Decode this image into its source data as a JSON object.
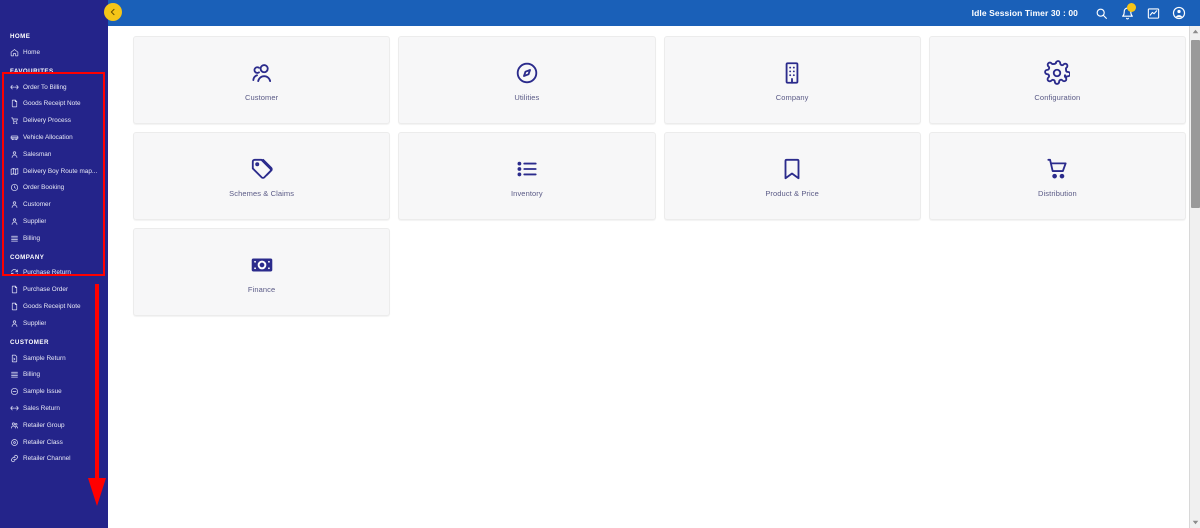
{
  "colors": {
    "header_blue": "#1a60b8",
    "sidebar_navy": "#24248a",
    "accent_yellow": "#f5c518",
    "icon_indigo": "#2b2b8c",
    "tile_bg": "#f7f7f8",
    "tile_label": "#5a5a86",
    "annotation_red": "#ff0000"
  },
  "topbar": {
    "collapse_icon": "chevron-left-icon",
    "idle_session_timer": "Idle Session Timer 30 : 00",
    "icons": [
      {
        "name": "search-icon",
        "label": "Search"
      },
      {
        "name": "notification-bell-icon",
        "label": "Notifications",
        "badge": ""
      },
      {
        "name": "analytics-chart-icon",
        "label": "Reports"
      },
      {
        "name": "user-account-icon",
        "label": "Account"
      }
    ]
  },
  "sidebar": {
    "scrollbar": {
      "up_arrow_icon": "caret-up-icon",
      "down_arrow_icon": "caret-down-icon"
    },
    "groups": [
      {
        "title": "HOME",
        "items": [
          {
            "label": "Home",
            "icon": "home-icon"
          }
        ]
      },
      {
        "title": "FAVOURITES",
        "items": [
          {
            "label": "Order To Billing",
            "icon": "arrows-horizontal-icon"
          },
          {
            "label": "Goods Receipt Note",
            "icon": "document-icon"
          },
          {
            "label": "Delivery Process",
            "icon": "delivery-cart-icon"
          },
          {
            "label": "Vehicle Allocation",
            "icon": "vehicle-icon"
          },
          {
            "label": "Salesman",
            "icon": "person-icon"
          },
          {
            "label": "Delivery Boy Route map...",
            "icon": "map-icon"
          },
          {
            "label": "Order Booking",
            "icon": "clock-icon"
          },
          {
            "label": "Customer",
            "icon": "person-icon"
          },
          {
            "label": "Supplier",
            "icon": "person-icon"
          },
          {
            "label": "Billing",
            "icon": "list-icon"
          }
        ]
      },
      {
        "title": "COMPANY",
        "items": [
          {
            "label": "Purchase Return",
            "icon": "refresh-icon"
          },
          {
            "label": "Purchase Order",
            "icon": "document-icon"
          },
          {
            "label": "Goods Receipt Note",
            "icon": "document-icon"
          },
          {
            "label": "Supplier",
            "icon": "person-icon"
          }
        ]
      },
      {
        "title": "CUSTOMER",
        "items": [
          {
            "label": "Sample Return",
            "icon": "document-arrow-icon"
          },
          {
            "label": "Billing",
            "icon": "list-icon"
          },
          {
            "label": "Sample Issue",
            "icon": "minus-circle-icon"
          },
          {
            "label": "Sales Return",
            "icon": "arrows-horizontal-icon"
          },
          {
            "label": "Retailer Group",
            "icon": "people-group-icon"
          },
          {
            "label": "Retailer Class",
            "icon": "target-icon"
          },
          {
            "label": "Retailer Channel",
            "icon": "link-icon"
          }
        ]
      }
    ]
  },
  "main": {
    "tiles": [
      {
        "label": "Customer",
        "icon": "people-icon"
      },
      {
        "label": "Utilities",
        "icon": "compass-icon"
      },
      {
        "label": "Company",
        "icon": "building-icon"
      },
      {
        "label": "Configuration",
        "icon": "gear-icon"
      },
      {
        "label": "Schemes & Claims",
        "icon": "tags-icon"
      },
      {
        "label": "Inventory",
        "icon": "list-bullet-icon"
      },
      {
        "label": "Product & Price",
        "icon": "bookmark-icon"
      },
      {
        "label": "Distribution",
        "icon": "shopping-cart-icon"
      },
      {
        "label": "Finance",
        "icon": "banknote-icon"
      }
    ]
  },
  "annotations": [
    {
      "name": "favourites-highlight-box",
      "shape": "rectangle",
      "color": "#ff0000"
    },
    {
      "name": "scroll-down-arrow-annotation",
      "shape": "arrow",
      "color": "#ff0000"
    }
  ]
}
